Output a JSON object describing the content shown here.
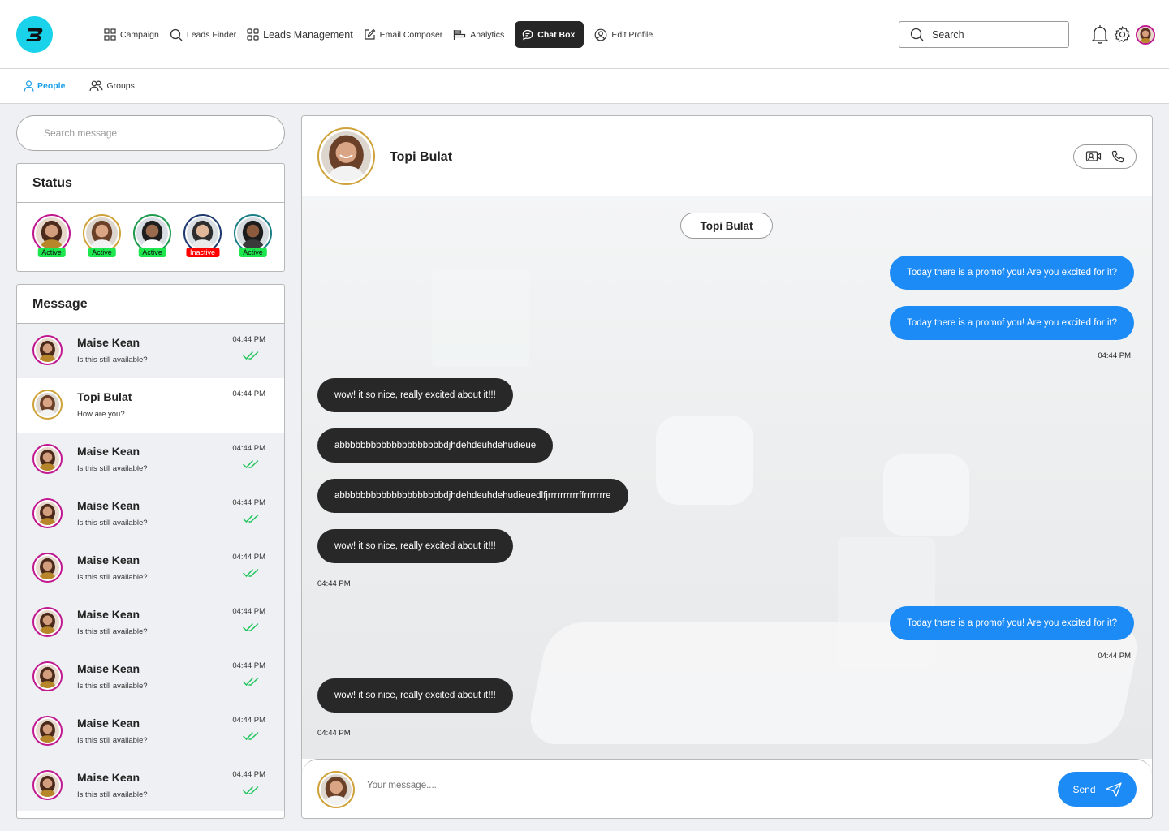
{
  "nav": {
    "items": [
      {
        "label": "Campaign",
        "icon": "grid-icon"
      },
      {
        "label": "Leads Finder",
        "icon": "search-icon"
      },
      {
        "label": "Leads Management",
        "icon": "grid-icon"
      },
      {
        "label": "Email Composer",
        "icon": "edit-icon"
      },
      {
        "label": "Analytics",
        "icon": "analytics-icon"
      },
      {
        "label": "Chat Box",
        "icon": "chat-icon"
      },
      {
        "label": "Edit Profile",
        "icon": "user-circle-icon"
      }
    ],
    "active": "Chat Box",
    "search_placeholder": "Search"
  },
  "subnav": {
    "tabs": [
      {
        "label": "People",
        "icon": "person-icon"
      },
      {
        "label": "Groups",
        "icon": "group-icon"
      }
    ],
    "active": "People"
  },
  "sidebar": {
    "search_placeholder": "Search message",
    "status_title": "Status",
    "statuses": [
      {
        "label": "Active",
        "state": "active",
        "ring": "#c01990"
      },
      {
        "label": "Active",
        "state": "active",
        "ring": "#cfa23a"
      },
      {
        "label": "Active",
        "state": "active",
        "ring": "#1f9a4f"
      },
      {
        "label": "Inactive",
        "state": "inactive",
        "ring": "#1f3a70"
      },
      {
        "label": "Active",
        "state": "active",
        "ring": "#1d7f88"
      }
    ],
    "message_title": "Message",
    "messages": [
      {
        "name": "Maise Kean",
        "preview": "Is this still available?",
        "time": "04:44 PM",
        "read": true
      },
      {
        "name": "Topi Bulat",
        "preview": "How are you?",
        "time": "04:44 PM",
        "read": false
      },
      {
        "name": "Maise Kean",
        "preview": "Is this still available?",
        "time": "04:44 PM",
        "read": true
      },
      {
        "name": "Maise Kean",
        "preview": "Is this still available?",
        "time": "04:44 PM",
        "read": true
      },
      {
        "name": "Maise Kean",
        "preview": "Is this still available?",
        "time": "04:44 PM",
        "read": true
      },
      {
        "name": "Maise Kean",
        "preview": "Is this still available?",
        "time": "04:44 PM",
        "read": true
      },
      {
        "name": "Maise Kean",
        "preview": "Is this still available?",
        "time": "04:44 PM",
        "read": true
      },
      {
        "name": "Maise Kean",
        "preview": "Is this still available?",
        "time": "04:44 PM",
        "read": true
      },
      {
        "name": "Maise Kean",
        "preview": "Is this still available?",
        "time": "04:44 PM",
        "read": true
      }
    ]
  },
  "chat": {
    "contact_name": "Topi Bulat",
    "date_pill": "Topi Bulat",
    "messages": [
      {
        "dir": "out",
        "text": "Today there is a promof you! Are you excited for it?"
      },
      {
        "dir": "out",
        "text": "Today there is a promof you! Are you excited for it?"
      },
      {
        "ts": "04:44 PM",
        "side": "right"
      },
      {
        "dir": "in",
        "text": "wow! it so nice, really excited about it!!!"
      },
      {
        "dir": "in",
        "text": "abbbbbbbbbbbbbbbbbbbbdjhdehdeuhdehudieue"
      },
      {
        "dir": "in",
        "text": "abbbbbbbbbbbbbbbbbbbbdjhdehdeuhdehudieuedlfjrrrrrrrrrrffrrrrrrre"
      },
      {
        "dir": "in",
        "text": "wow! it so nice, really excited about it!!!"
      },
      {
        "ts": "04:44 PM",
        "side": "left"
      },
      {
        "dir": "out",
        "text": "Today there is a promof you! Are you excited for it?"
      },
      {
        "ts": "04:44 PM",
        "side": "right"
      },
      {
        "dir": "in",
        "text": "wow! it so nice, really excited about it!!!"
      },
      {
        "ts": "04:44 PM",
        "side": "left"
      }
    ],
    "composer_placeholder": "Your message....",
    "send_label": "Send"
  },
  "colors": {
    "accent": "#1d8bf5",
    "logo": "#1ad3ea",
    "active_tab": "#1aa0e8",
    "incoming_bubble": "#282828",
    "active_badge": "#1de64e",
    "inactive_badge": "#ff0000",
    "read_check": "#22c55e"
  }
}
